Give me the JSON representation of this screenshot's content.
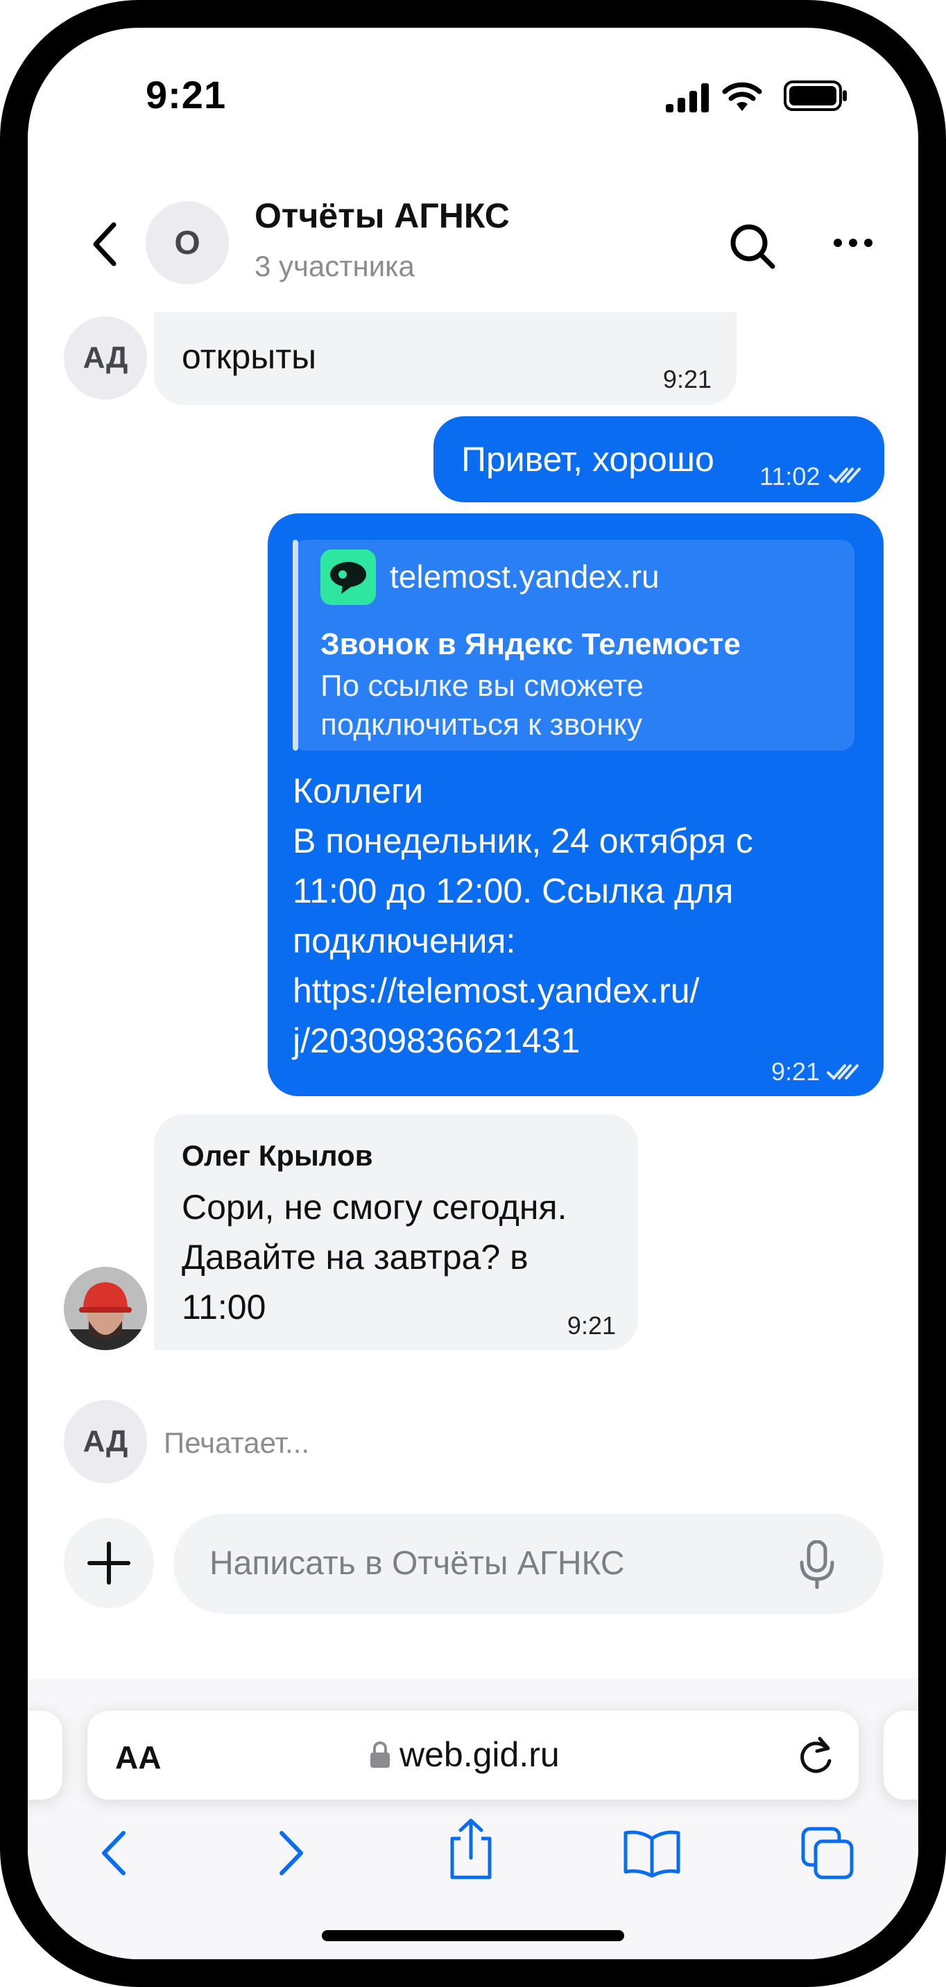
{
  "status_bar": {
    "time": "9:21"
  },
  "header": {
    "avatar_letter": "О",
    "title": "Отчёты АГНКС",
    "subtitle": "3 участника"
  },
  "messages": [
    {
      "avatar": "АД",
      "text": "открыты",
      "time": "9:21"
    },
    {
      "text": "Привет, хорошо",
      "time": "11:02"
    },
    {
      "preview": {
        "domain": "telemost.yandex.ru",
        "title": "Звонок в Яндекс Телемосте",
        "desc_line1": "По ссылке вы сможете",
        "desc_line2": "подключиться к звонку"
      },
      "lines": [
        "Коллеги",
        "В понедельник, 24 октября с",
        "11:00 до 12:00. Ссылка для",
        "подключения:",
        "https://telemost.yandex.ru/",
        "j/20309836621431"
      ],
      "time": "9:21"
    },
    {
      "sender": "Олег Крылов",
      "lines": [
        "Сори, не смогу сегодня.",
        "Давайте на завтра? в",
        "11:00"
      ],
      "time": "9:21"
    }
  ],
  "typing": {
    "avatar": "АД",
    "text": "Печатает..."
  },
  "composer": {
    "placeholder": "Написать в Отчёты АГНКС"
  },
  "browser": {
    "text_size_label": "AA",
    "url": "web.gid.ru"
  },
  "colors": {
    "accent": "#0A6CF0",
    "bubble_in": "#F2F3F5",
    "telemost_icon": "#2EE6A0"
  },
  "icons": [
    "back-chevron-icon",
    "search-icon",
    "more-icon",
    "read-receipt-icon",
    "telemost-icon",
    "plus-icon",
    "mic-icon",
    "lock-icon",
    "reload-icon",
    "browser-back-icon",
    "browser-forward-icon",
    "share-icon",
    "bookmarks-icon",
    "tabs-icon"
  ]
}
